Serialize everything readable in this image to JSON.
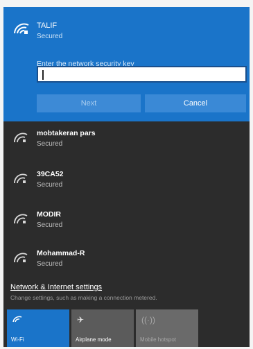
{
  "selected_network": {
    "name": "TALIF",
    "status": "Secured",
    "key_label": "Enter the network security key",
    "key_value": "",
    "icon": "wifi-secured-icon"
  },
  "buttons": {
    "next_label": "Next",
    "cancel_label": "Cancel"
  },
  "networks": [
    {
      "name": "mobtakeran pars",
      "status": "Secured",
      "icon": "wifi-secured-icon"
    },
    {
      "name": "39CA52",
      "status": "Secured",
      "icon": "wifi-secured-icon"
    },
    {
      "name": "MODIR",
      "status": "Secured",
      "icon": "wifi-secured-icon"
    },
    {
      "name": "Mohammad-R",
      "status": "Secured",
      "icon": "wifi-secured-icon"
    }
  ],
  "settings": {
    "link": "Network & Internet settings",
    "description": "Change settings, such as making a connection metered."
  },
  "quick_actions": [
    {
      "label": "Wi-Fi",
      "icon": "wifi-icon",
      "state": "on"
    },
    {
      "label": "Airplane mode",
      "icon": "airplane-icon",
      "state": "off"
    },
    {
      "label": "Mobile hotspot",
      "icon": "hotspot-icon",
      "state": "disabled"
    }
  ],
  "colors": {
    "accent": "#1a74c9",
    "panel": "#2c2c2c"
  }
}
